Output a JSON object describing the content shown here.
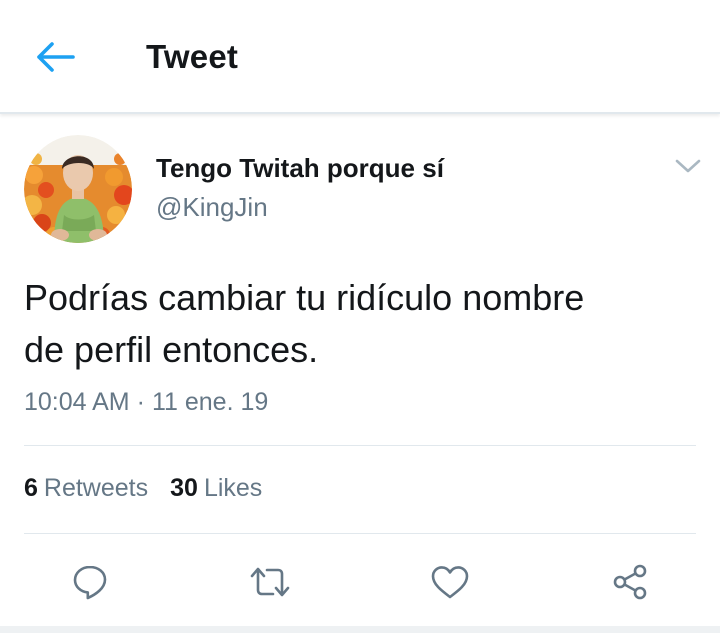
{
  "header": {
    "title": "Tweet",
    "back_icon": "arrow-left-icon"
  },
  "author": {
    "display_name": "Tengo Twitah porque sí",
    "handle": "@KingJin",
    "avatar": "profile-photo"
  },
  "tweet": {
    "text_line1": "Podrías cambiar tu ridículo nombre",
    "text_line2": "de perfil entonces.",
    "time": "10:04 AM",
    "separator": "·",
    "date": "11 ene. 19"
  },
  "stats": {
    "retweets_count": "6",
    "retweets_label": "Retweets",
    "likes_count": "30",
    "likes_label": "Likes"
  },
  "actions": [
    "reply-icon",
    "retweet-icon",
    "like-icon",
    "share-icon"
  ],
  "colors": {
    "accent": "#1da1f2",
    "text": "#14171a",
    "secondary": "#657786",
    "divider": "#e1e8ed"
  }
}
